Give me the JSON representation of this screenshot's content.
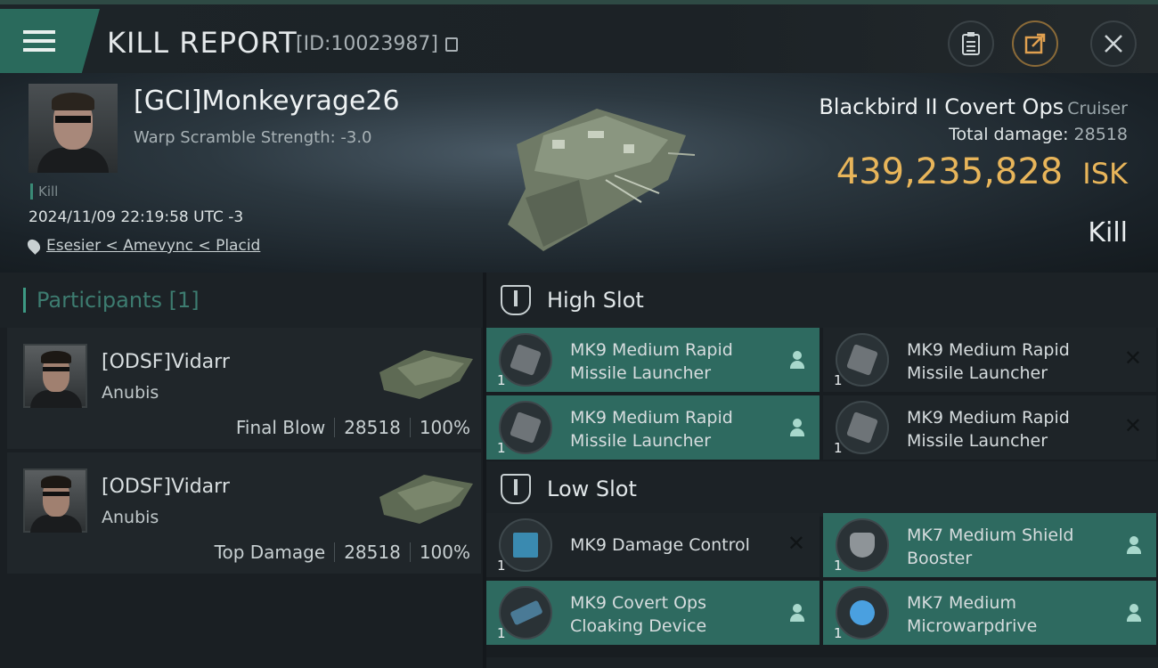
{
  "header": {
    "title": "KILL REPORT",
    "id_text": "[ID:10023987]",
    "icons": [
      "menu-icon",
      "clipboard-icon",
      "share-icon",
      "close-icon"
    ]
  },
  "victim": {
    "name": "[GCI]Monkeyrage26",
    "warp_scramble": "Warp Scramble Strength: -3.0",
    "kill_tag": "Kill",
    "datetime": "2024/11/09 22:19:58 UTC -3",
    "location": "Esesier < Amevync < Placid",
    "ship_name": "Blackbird II Covert Ops",
    "ship_class": "Cruiser",
    "total_damage_label": "Total damage:",
    "total_damage_value": "28518",
    "isk_value": "439,235,828",
    "isk_unit": "ISK",
    "result": "Kill"
  },
  "participants": {
    "title": "Participants",
    "count": "[1]",
    "rows": [
      {
        "name": "[ODSF]Vidarr",
        "ship": "Anubis",
        "role": "Final Blow",
        "damage": "28518",
        "percent": "100%"
      },
      {
        "name": "[ODSF]Vidarr",
        "ship": "Anubis",
        "role": "Top Damage",
        "damage": "28518",
        "percent": "100%"
      }
    ]
  },
  "slots": {
    "high": {
      "label": "High Slot",
      "items": [
        {
          "name": "MK9 Medium Rapid Missile Launcher",
          "qty": "1",
          "state": "dropped"
        },
        {
          "name": "MK9 Medium Rapid Missile Launcher",
          "qty": "1",
          "state": "destroyed"
        },
        {
          "name": "MK9 Medium Rapid Missile Launcher",
          "qty": "1",
          "state": "dropped"
        },
        {
          "name": "MK9 Medium Rapid Missile Launcher",
          "qty": "1",
          "state": "destroyed"
        }
      ]
    },
    "low": {
      "label": "Low Slot",
      "items": [
        {
          "name": "MK9 Damage Control",
          "qty": "1",
          "state": "destroyed"
        },
        {
          "name": "MK7 Medium Shield Booster",
          "qty": "1",
          "state": "dropped"
        },
        {
          "name": "MK9 Covert Ops Cloaking Device",
          "qty": "1",
          "state": "dropped"
        },
        {
          "name": "MK7 Medium Microwarpdrive",
          "qty": "1",
          "state": "dropped"
        }
      ]
    }
  },
  "colors": {
    "accent_green": "#2e6a60",
    "isk_gold": "#e8b55a",
    "header_teal": "#2a6a5c"
  }
}
